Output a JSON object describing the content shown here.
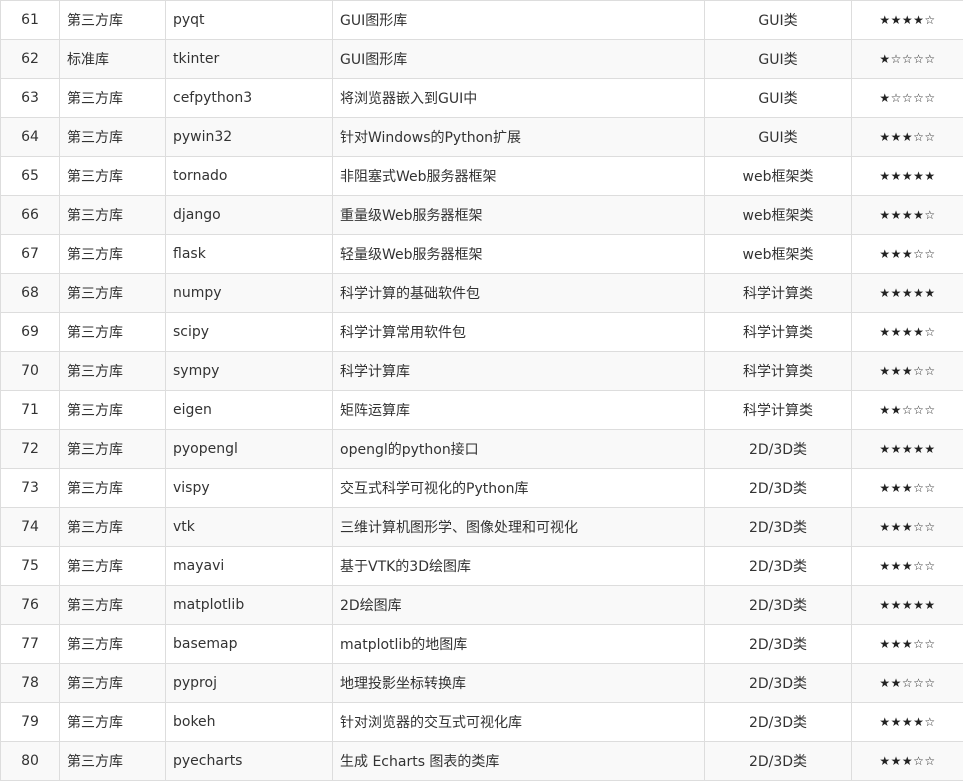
{
  "rows": [
    {
      "num": "61",
      "type": "第三方库",
      "name": "pyqt",
      "desc": "GUI图形库",
      "category": "GUI类",
      "rating": "★★★★☆"
    },
    {
      "num": "62",
      "type": "标准库",
      "name": "tkinter",
      "desc": "GUI图形库",
      "category": "GUI类",
      "rating": "★☆☆☆☆"
    },
    {
      "num": "63",
      "type": "第三方库",
      "name": "cefpython3",
      "desc": "将浏览器嵌入到GUI中",
      "category": "GUI类",
      "rating": "★☆☆☆☆"
    },
    {
      "num": "64",
      "type": "第三方库",
      "name": "pywin32",
      "desc": "针对Windows的Python扩展",
      "category": "GUI类",
      "rating": "★★★☆☆"
    },
    {
      "num": "65",
      "type": "第三方库",
      "name": "tornado",
      "desc": "非阻塞式Web服务器框架",
      "category": "web框架类",
      "rating": "★★★★★"
    },
    {
      "num": "66",
      "type": "第三方库",
      "name": "django",
      "desc": "重量级Web服务器框架",
      "category": "web框架类",
      "rating": "★★★★☆"
    },
    {
      "num": "67",
      "type": "第三方库",
      "name": "flask",
      "desc": "轻量级Web服务器框架",
      "category": "web框架类",
      "rating": "★★★☆☆"
    },
    {
      "num": "68",
      "type": "第三方库",
      "name": "numpy",
      "desc": "科学计算的基础软件包",
      "category": "科学计算类",
      "rating": "★★★★★"
    },
    {
      "num": "69",
      "type": "第三方库",
      "name": "scipy",
      "desc": "科学计算常用软件包",
      "category": "科学计算类",
      "rating": "★★★★☆"
    },
    {
      "num": "70",
      "type": "第三方库",
      "name": "sympy",
      "desc": "科学计算库",
      "category": "科学计算类",
      "rating": "★★★☆☆"
    },
    {
      "num": "71",
      "type": "第三方库",
      "name": "eigen",
      "desc": "矩阵运算库",
      "category": "科学计算类",
      "rating": "★★☆☆☆"
    },
    {
      "num": "72",
      "type": "第三方库",
      "name": "pyopengl",
      "desc": "opengl的python接口",
      "category": "2D/3D类",
      "rating": "★★★★★"
    },
    {
      "num": "73",
      "type": "第三方库",
      "name": "vispy",
      "desc": "交互式科学可视化的Python库",
      "category": "2D/3D类",
      "rating": "★★★☆☆"
    },
    {
      "num": "74",
      "type": "第三方库",
      "name": "vtk",
      "desc": "三维计算机图形学、图像处理和可视化",
      "category": "2D/3D类",
      "rating": "★★★☆☆"
    },
    {
      "num": "75",
      "type": "第三方库",
      "name": "mayavi",
      "desc": "基于VTK的3D绘图库",
      "category": "2D/3D类",
      "rating": "★★★☆☆"
    },
    {
      "num": "76",
      "type": "第三方库",
      "name": "matplotlib",
      "desc": "2D绘图库",
      "category": "2D/3D类",
      "rating": "★★★★★"
    },
    {
      "num": "77",
      "type": "第三方库",
      "name": "basemap",
      "desc": "matplotlib的地图库",
      "category": "2D/3D类",
      "rating": "★★★☆☆"
    },
    {
      "num": "78",
      "type": "第三方库",
      "name": "pyproj",
      "desc": "地理投影坐标转换库",
      "category": "2D/3D类",
      "rating": "★★☆☆☆"
    },
    {
      "num": "79",
      "type": "第三方库",
      "name": "bokeh",
      "desc": "针对浏览器的交互式可视化库",
      "category": "2D/3D类",
      "rating": "★★★★☆"
    },
    {
      "num": "80",
      "type": "第三方库",
      "name": "pyecharts",
      "desc": "生成 Echarts 图表的类库",
      "category": "2D/3D类",
      "rating": "★★★☆☆"
    }
  ]
}
